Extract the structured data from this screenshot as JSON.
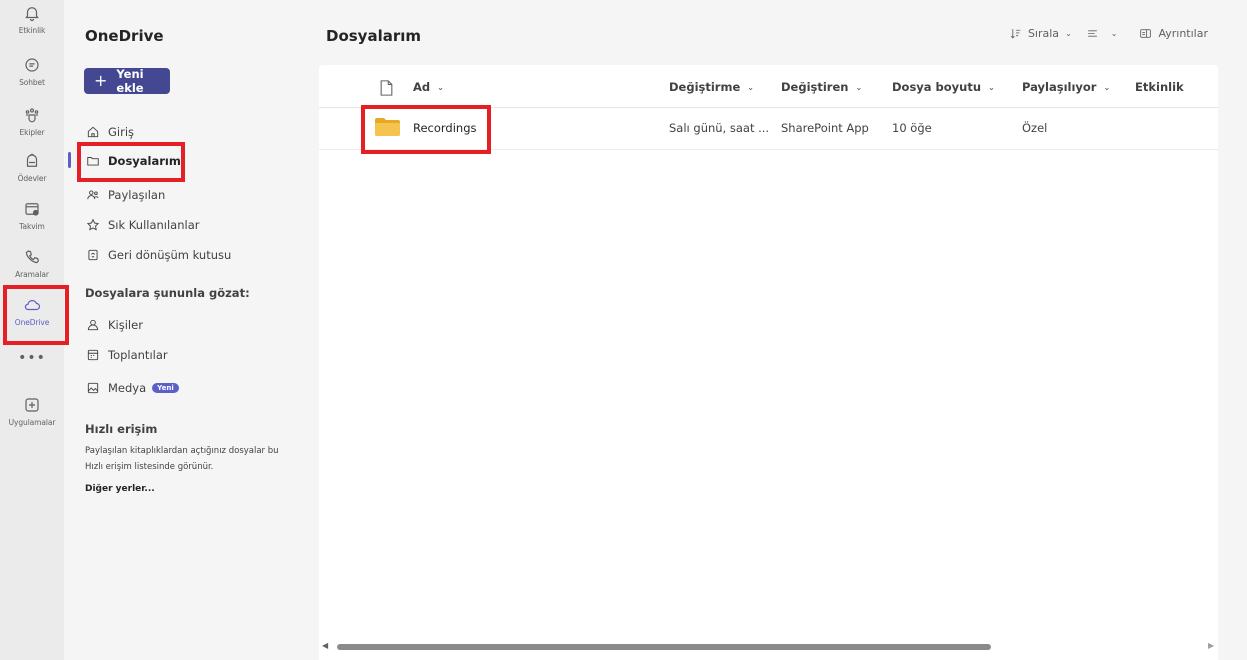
{
  "appbar": {
    "items": [
      {
        "label": "Etkinlik",
        "icon": "bell-icon"
      },
      {
        "label": "Sohbet",
        "icon": "chat-icon"
      },
      {
        "label": "Ekipler",
        "icon": "teams-icon"
      },
      {
        "label": "Ödevler",
        "icon": "assignments-icon"
      },
      {
        "label": "Takvim",
        "icon": "calendar-icon"
      },
      {
        "label": "Aramalar",
        "icon": "phone-icon"
      },
      {
        "label": "OneDrive",
        "icon": "cloud-icon"
      },
      {
        "label": "Uygulamalar",
        "icon": "add-app-icon"
      }
    ],
    "more": "•••",
    "active": "OneDrive"
  },
  "nav": {
    "title": "OneDrive",
    "new_button": "Yeni ekle",
    "items": [
      {
        "label": "Giriş",
        "icon": "home-icon"
      },
      {
        "label": "Dosyalarım",
        "icon": "folder-icon"
      },
      {
        "label": "Paylaşılan",
        "icon": "people-icon"
      },
      {
        "label": "Sık Kullanılanlar",
        "icon": "star-icon"
      },
      {
        "label": "Geri dönüşüm kutusu",
        "icon": "recycle-bin-icon"
      }
    ],
    "browse_title": "Dosyalara şununla gözat:",
    "browse_items": [
      {
        "label": "Kişiler",
        "icon": "person-icon"
      },
      {
        "label": "Toplantılar",
        "icon": "meetings-icon"
      },
      {
        "label": "Medya",
        "icon": "media-icon",
        "badge": "Yeni"
      }
    ],
    "quick_access_title": "Hızlı erişim",
    "quick_access_text": "Paylaşılan kitaplıklardan açtığınız dosyalar bu Hızlı erişim listesinde görünür.",
    "other_places": "Diğer yerler..."
  },
  "main": {
    "title": "Dosyalarım",
    "toolbar": {
      "sort_label": "Sırala",
      "details_label": "Ayrıntılar"
    },
    "columns": {
      "name": "Ad",
      "modified": "Değiştirme",
      "modified_by": "Değiştiren",
      "size": "Dosya boyutu",
      "sharing": "Paylaşılıyor",
      "activity": "Etkinlik"
    },
    "rows": [
      {
        "name": "Recordings",
        "modified": "Salı günü, saat ...",
        "modified_by": "SharePoint App",
        "size": "10 öğe",
        "sharing": "Özel",
        "icon": "folder-icon"
      }
    ]
  },
  "colors": {
    "accent": "#5b5fc7",
    "button": "#444791",
    "highlight_box": "#e41f26",
    "folder": "#f4c44e"
  }
}
